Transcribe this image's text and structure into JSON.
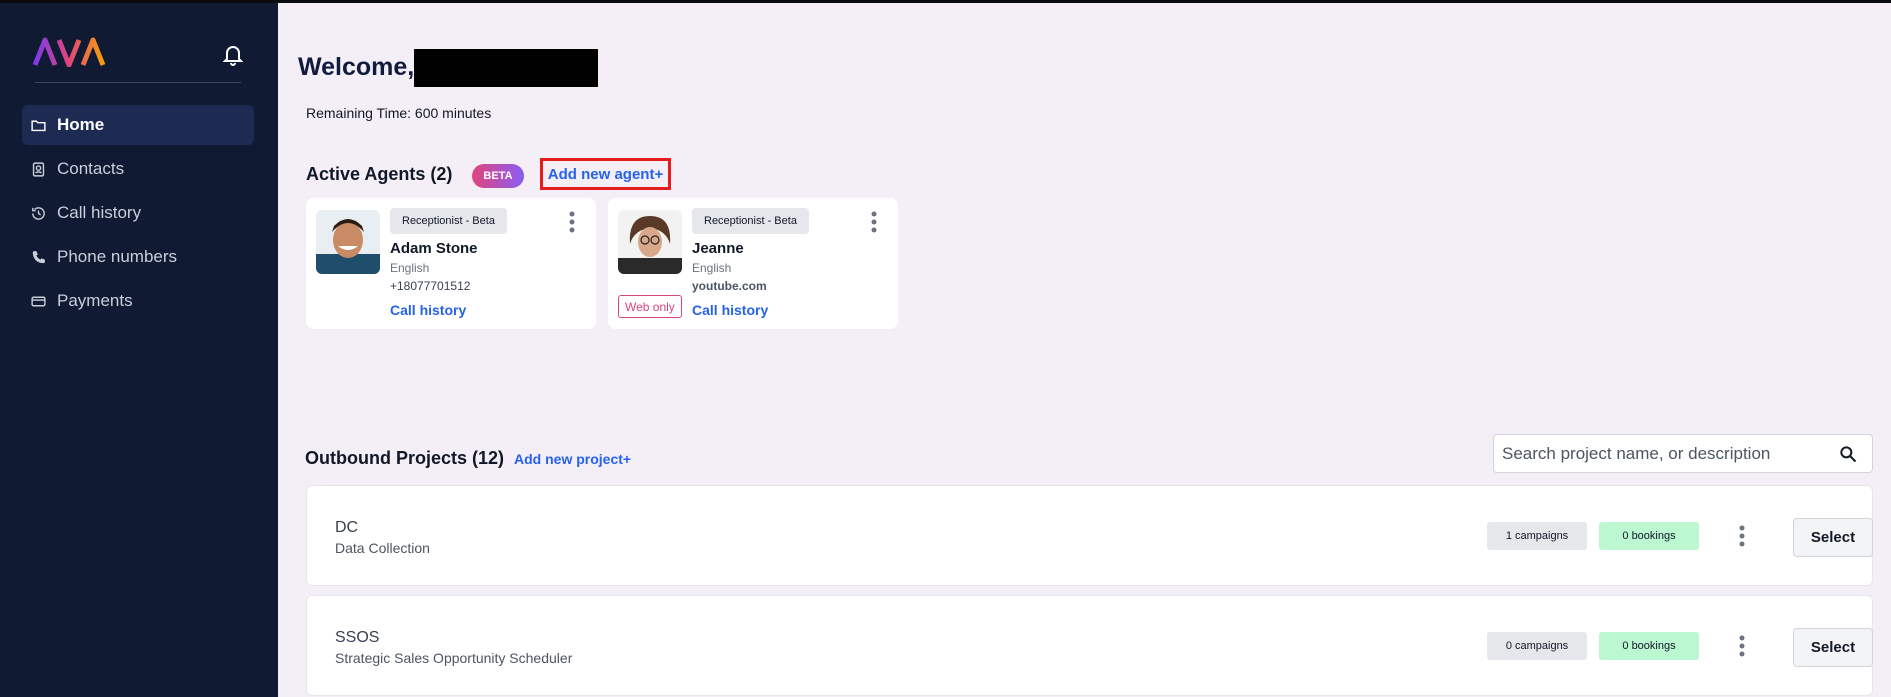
{
  "sidebar": {
    "brand": "AVA",
    "nav": [
      {
        "label": "Home",
        "icon": "folder-icon",
        "active": true
      },
      {
        "label": "Contacts",
        "icon": "contacts-icon",
        "active": false
      },
      {
        "label": "Call history",
        "icon": "history-icon",
        "active": false
      },
      {
        "label": "Phone numbers",
        "icon": "phone-icon",
        "active": false
      },
      {
        "label": "Payments",
        "icon": "card-icon",
        "active": false
      }
    ]
  },
  "header": {
    "welcome": "Welcome,",
    "remaining": "Remaining Time: 600 minutes"
  },
  "agents": {
    "title": "Active Agents (2)",
    "beta_badge": "BETA",
    "add_label": "Add new agent+",
    "items": [
      {
        "role": "Receptionist - Beta",
        "name": "Adam Stone",
        "language": "English",
        "contact": "+18077701512",
        "call_history": "Call history"
      },
      {
        "role": "Receptionist - Beta",
        "name": "Jeanne",
        "language": "English",
        "contact": "youtube.com",
        "badge": "Web only",
        "call_history": "Call history"
      }
    ]
  },
  "outbound": {
    "title": "Outbound Projects (12)",
    "add_label": "Add new project+",
    "search_placeholder": "Search project name, or description",
    "projects": [
      {
        "name": "DC",
        "description": "Data Collection",
        "campaigns": "1 campaigns",
        "bookings": "0 bookings",
        "select": "Select"
      },
      {
        "name": "SSOS",
        "description": "Strategic Sales Opportunity Scheduler",
        "campaigns": "0 campaigns",
        "bookings": "0 bookings",
        "select": "Select"
      }
    ]
  },
  "colors": {
    "sidebar_bg": "#101a33",
    "accent_link": "#2563eb",
    "highlight_border": "#e41c1c",
    "bookings_bg": "#bbf7d0"
  }
}
